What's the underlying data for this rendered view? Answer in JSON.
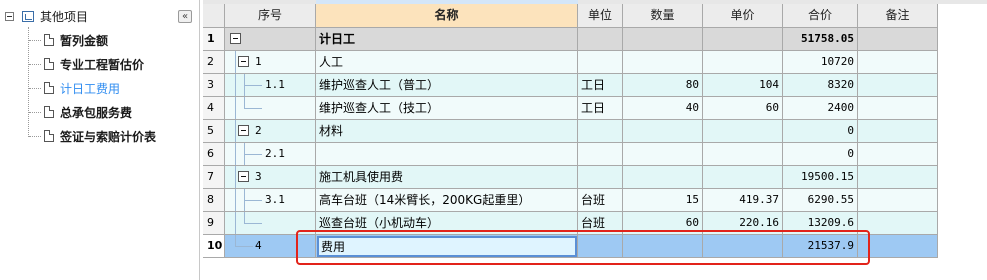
{
  "tree": {
    "root_label": "其他项目",
    "collapse_glyph": "«",
    "items": [
      {
        "label": "暂列金额",
        "active": false
      },
      {
        "label": "专业工程暂估价",
        "active": false
      },
      {
        "label": "计日工费用",
        "active": true
      },
      {
        "label": "总承包服务费",
        "active": false
      },
      {
        "label": "签证与索赔计价表",
        "active": false
      }
    ]
  },
  "grid": {
    "columns": [
      "序号",
      "名称",
      "单位",
      "数量",
      "单价",
      "合价",
      "备注"
    ],
    "selected_column": "名称",
    "rows": [
      {
        "n": "1",
        "seq": "",
        "name": "计日工",
        "unit": "",
        "qty": "",
        "price": "",
        "total": "51758.05",
        "remark": ""
      },
      {
        "n": "2",
        "seq": "1",
        "name": "人工",
        "unit": "",
        "qty": "",
        "price": "",
        "total": "10720",
        "remark": ""
      },
      {
        "n": "3",
        "seq": "1.1",
        "name": "维护巡查人工（普工）",
        "unit": "工日",
        "qty": "80",
        "price": "104",
        "total": "8320",
        "remark": ""
      },
      {
        "n": "4",
        "seq": "",
        "name": "维护巡查人工（技工）",
        "unit": "工日",
        "qty": "40",
        "price": "60",
        "total": "2400",
        "remark": ""
      },
      {
        "n": "5",
        "seq": "2",
        "name": "材料",
        "unit": "",
        "qty": "",
        "price": "",
        "total": "0",
        "remark": ""
      },
      {
        "n": "6",
        "seq": "2.1",
        "name": "",
        "unit": "",
        "qty": "",
        "price": "",
        "total": "0",
        "remark": ""
      },
      {
        "n": "7",
        "seq": "3",
        "name": "施工机具使用费",
        "unit": "",
        "qty": "",
        "price": "",
        "total": "19500.15",
        "remark": ""
      },
      {
        "n": "8",
        "seq": "3.1",
        "name": "高车台班（14米臂长，200KG起重里）",
        "unit": "台班",
        "qty": "15",
        "price": "419.37",
        "total": "6290.55",
        "remark": ""
      },
      {
        "n": "9",
        "seq": "",
        "name": "巡查台班（小机动车）",
        "unit": "台班",
        "qty": "60",
        "price": "220.16",
        "total": "13209.6",
        "remark": ""
      },
      {
        "n": "10",
        "seq": "4",
        "name": "费用",
        "unit": "",
        "qty": "",
        "price": "",
        "total": "21537.9",
        "remark": ""
      }
    ],
    "selected_row": "10",
    "colors": {
      "row_header": "#d9d9d9",
      "row_level1": "#f1fbfb",
      "row_alt": "#e2f7f7",
      "row_selected": "#9ec9f3",
      "highlight_frame": "#e2231a"
    }
  }
}
